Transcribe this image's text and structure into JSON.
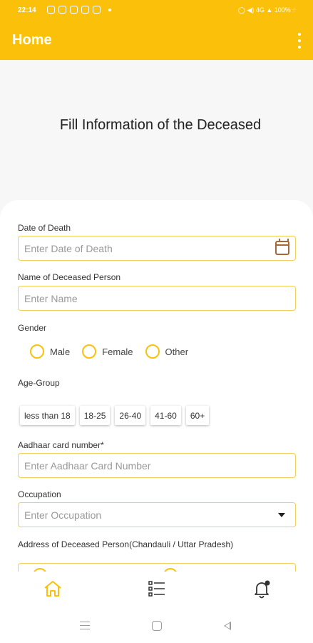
{
  "status_bar": {
    "time": "22:14",
    "right_text": "¹⁄ « 4G 100% ⚡",
    "battery": "100%"
  },
  "app_bar": {
    "title": "Home"
  },
  "page": {
    "heading": "Fill Information of the Deceased"
  },
  "form": {
    "date_of_death": {
      "label": "Date of Death",
      "placeholder": "Enter Date of Death"
    },
    "name": {
      "label": "Name of Deceased Person",
      "placeholder": "Enter Name"
    },
    "gender": {
      "label": "Gender",
      "options": [
        "Male",
        "Female",
        "Other"
      ]
    },
    "age_group": {
      "label": "Age-Group",
      "options": [
        "less than 18",
        "18-25",
        "26-40",
        "41-60",
        "60+"
      ]
    },
    "aadhaar": {
      "label": "Aadhaar card number*",
      "placeholder": "Enter Aadhaar Card Number"
    },
    "occupation": {
      "label": "Occupation",
      "placeholder": "Enter Occupation"
    },
    "address": {
      "label": "Address of Deceased Person(Chandauli / Uttar Pradesh)"
    }
  },
  "colors": {
    "accent": "#fbc10a",
    "field_border": "#f2cf5a",
    "calendar_icon": "#a26a3a"
  },
  "bottom_nav": {
    "items": [
      "home-icon",
      "list-icon",
      "bell-icon"
    ]
  }
}
